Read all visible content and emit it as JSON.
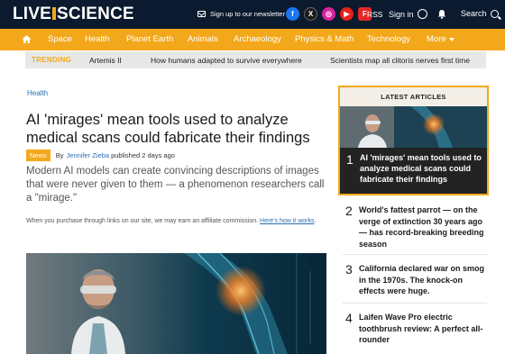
{
  "header": {
    "logo_part1": "LIVE",
    "logo_part2": "SCIENCE",
    "newsletter": "Sign up to our newsletter",
    "rss": "RSS",
    "sign_in": "Sign in",
    "search": "Search",
    "social_icons": [
      "facebook-icon",
      "x-icon",
      "instagram-icon",
      "youtube-icon",
      "flipboard-icon"
    ]
  },
  "nav": {
    "items": [
      "Space",
      "Health",
      "Planet Earth",
      "Animals",
      "Archaeology",
      "Physics & Math",
      "Technology"
    ],
    "more": "More"
  },
  "trending": {
    "label": "TRENDING",
    "items": [
      "Artemis II",
      "How humans adapted to survive everywhere",
      "Scientists map all clitoris nerves first time"
    ]
  },
  "article": {
    "category": "Health",
    "title": "AI 'mirages' mean tools used to analyze medical scans could fabricate their findings",
    "badge": "News",
    "by": "By",
    "author": "Jennifer Zieba",
    "published": "published 2 days ago",
    "standfirst": "Modern AI models can create convincing descriptions of images that were never given to them — a phenomenon researchers call a \"mirage.\"",
    "affiliate_text": "When you purchase through links on our site, we may earn an affiliate commission.",
    "affiliate_link": "Here's how it works",
    "affiliate_end": "."
  },
  "latest": {
    "heading": "LATEST ARTICLES",
    "items": [
      {
        "num": "1",
        "title": "AI 'mirages' mean tools used to analyze medical scans could fabricate their findings"
      },
      {
        "num": "2",
        "title": "World's fattest parrot — on the verge of extinction 30 years ago — has record-breaking breeding season"
      },
      {
        "num": "3",
        "title": "California declared war on smog in the 1970s. The knock-on effects were huge."
      },
      {
        "num": "4",
        "title": "Laifen Wave Pro electric toothbrush review: A perfect all-rounder"
      }
    ]
  },
  "colors": {
    "brand_orange": "#f3a81b",
    "header_navy": "#0b1a2e",
    "link_blue": "#2a6fb0"
  }
}
